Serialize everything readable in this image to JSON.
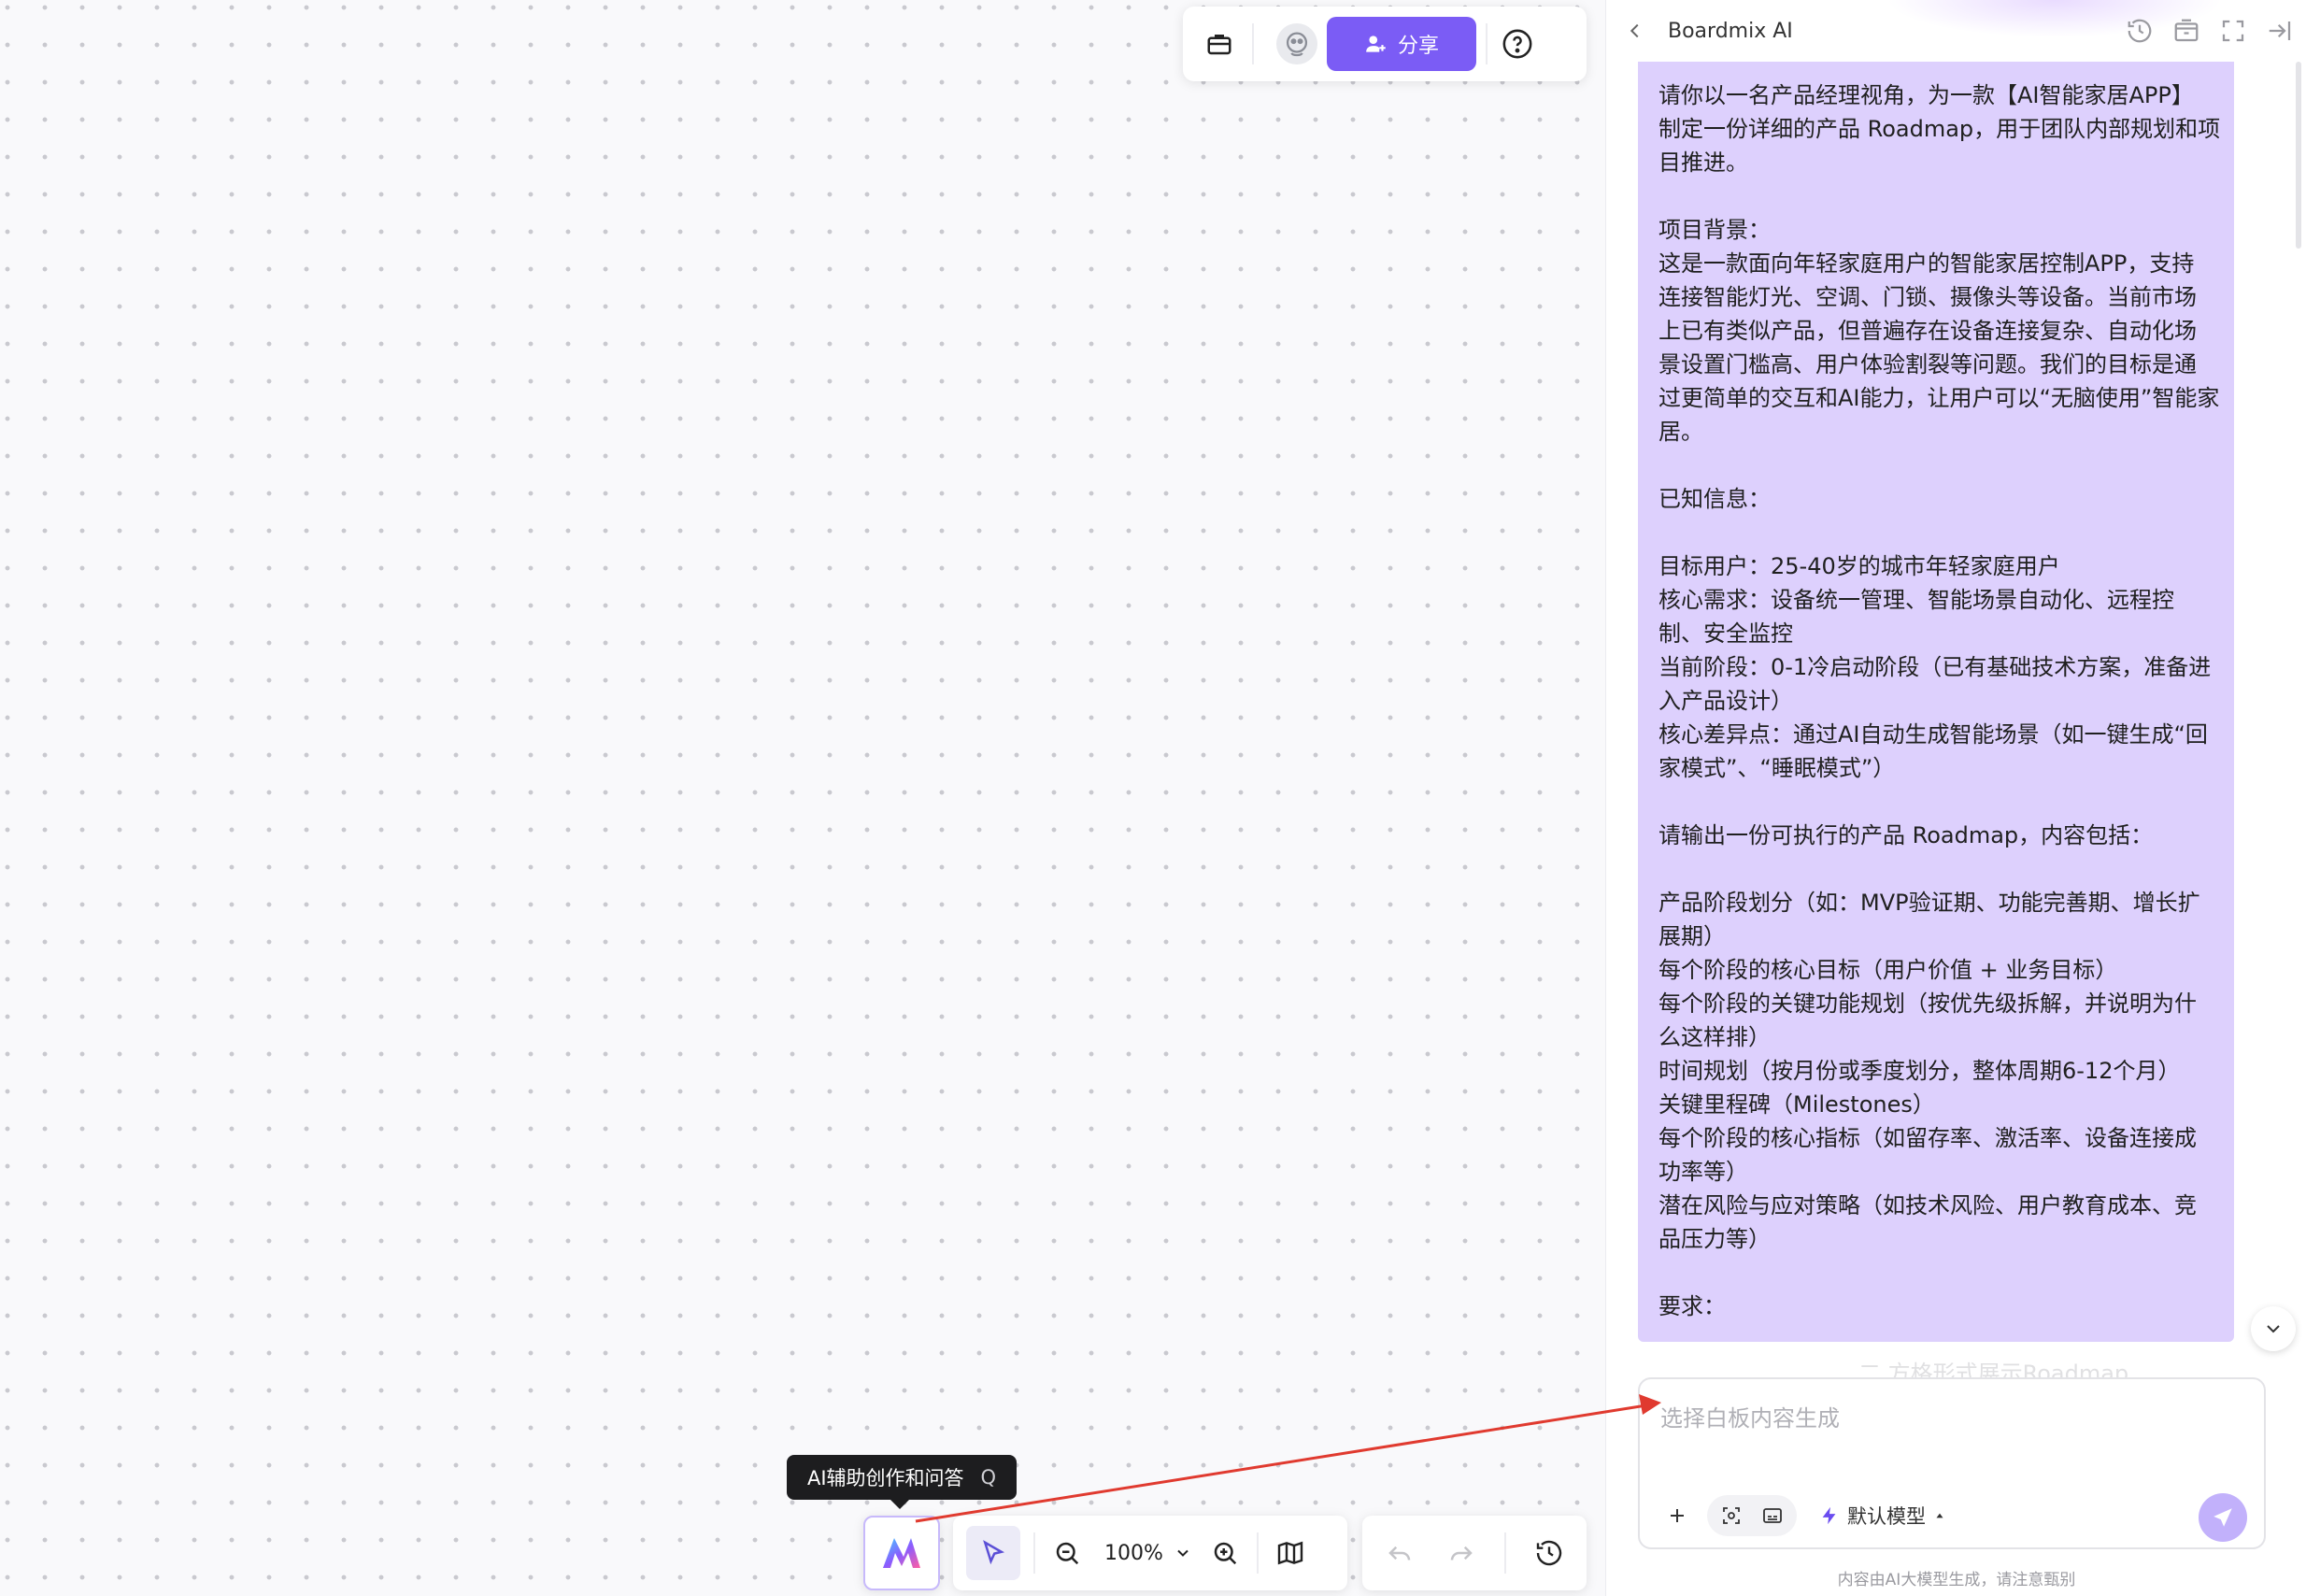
{
  "top_toolbar": {
    "share_label": "分享"
  },
  "tooltip": {
    "label": "AI辅助创作和问答",
    "shortcut": "Q"
  },
  "bottom_toolbar": {
    "zoom_level": "100%"
  },
  "panel": {
    "title": "Boardmix AI",
    "message_lines": [
      "请你以一名产品经理视角，为一款【AI智能家居APP】",
      "制定一份详细的产品 Roadmap，用于团队内部规划和项",
      "目推进。",
      "",
      "项目背景：",
      "这是一款面向年轻家庭用户的智能家居控制APP，支持",
      "连接智能灯光、空调、门锁、摄像头等设备。当前市场",
      "上已有类似产品，但普遍存在设备连接复杂、自动化场",
      "景设置门槛高、用户体验割裂等问题。我们的目标是通",
      "过更简单的交互和AI能力，让用户可以“无脑使用”智能家",
      "居。",
      "",
      "已知信息：",
      "",
      "目标用户：25-40岁的城市年轻家庭用户",
      "核心需求：设备统一管理、智能场景自动化、远程控",
      "制、安全监控",
      "当前阶段：0-1冷启动阶段（已有基础技术方案，准备进",
      "入产品设计）",
      "核心差异点：通过AI自动生成智能场景（如一键生成“回",
      "家模式”、“睡眠模式”）",
      "",
      "请输出一份可执行的产品 Roadmap，内容包括：",
      "",
      "产品阶段划分（如：MVP验证期、功能完善期、增长扩",
      "展期）",
      "每个阶段的核心目标（用户价值 + 业务目标）",
      "每个阶段的关键功能规划（按优先级拆解，并说明为什",
      "么这样排）",
      "时间规划（按月份或季度划分，整体周期6-12个月）",
      "关键里程碑（Milestones）",
      "每个阶段的核心指标（如留存率、激活率、设备连接成",
      "功率等）",
      "潜在风险与应对策略（如技术风险、用户教育成本、竞",
      "品压力等）",
      "",
      "要求："
    ],
    "faded_line": "二.方格形式展示Roadmap",
    "input_placeholder": "选择白板内容生成",
    "model_label": "默认模型",
    "disclaimer": "内容由AI大模型生成，请注意甄别"
  },
  "colors": {
    "accent": "#7b5cf5",
    "bubble": "#ddd0fd",
    "annotation_arrow": "#e03a2f"
  }
}
